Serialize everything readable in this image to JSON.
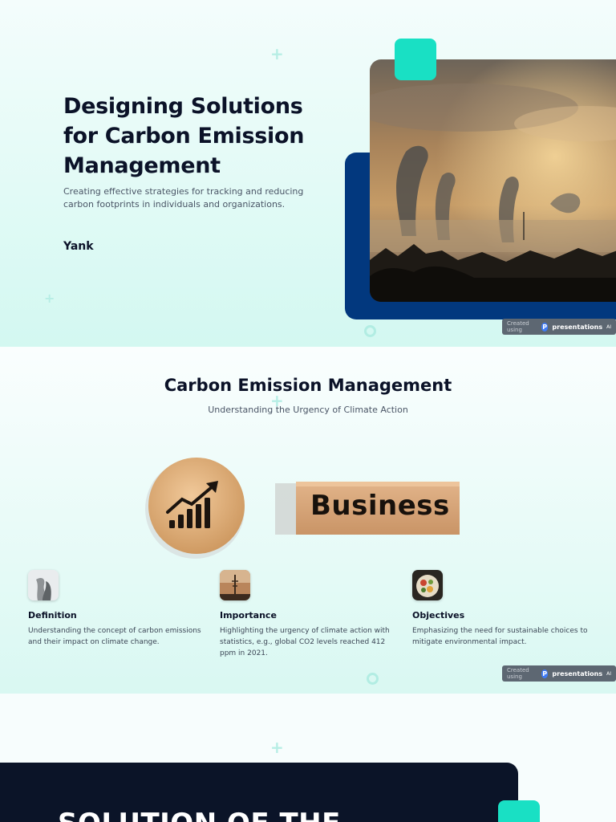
{
  "slide1": {
    "title": "Designing Solutions for Carbon Emission Management",
    "subtitle": "Creating effective strategies for tracking and reducing carbon footprints in individuals and organizations.",
    "author": "Yank",
    "image_icon": "factory-smoke-photo",
    "badge": {
      "prefix": "Created using",
      "brand": "presentations",
      "suffix": "AI"
    }
  },
  "slide2": {
    "title": "Carbon Emission Management",
    "subtitle": "Understanding the Urgency of Climate Action",
    "hero_block_label": "Business",
    "hero_icon": "growth-chart-icon",
    "cards": [
      {
        "title": "Definition",
        "text": "Understanding the concept of carbon emissions and their impact on climate change.",
        "icon": "smoke-thumbnail"
      },
      {
        "title": "Importance",
        "text": "Highlighting the urgency of climate action with statistics, e.g., global CO2 levels reached 412 ppm in 2021.",
        "icon": "tower-thumbnail"
      },
      {
        "title": "Objectives",
        "text": "Emphasizing the need for sustainable choices to mitigate environmental impact.",
        "icon": "food-bowl-thumbnail"
      }
    ],
    "badge": {
      "prefix": "Created using",
      "brand": "presentations",
      "suffix": "AI"
    }
  },
  "slide3": {
    "title_partial": "SOLUTION OF THE"
  },
  "colors": {
    "navy": "#02387e",
    "teal": "#19e0c4",
    "dark": "#0b1428",
    "text": "#0b1228"
  }
}
